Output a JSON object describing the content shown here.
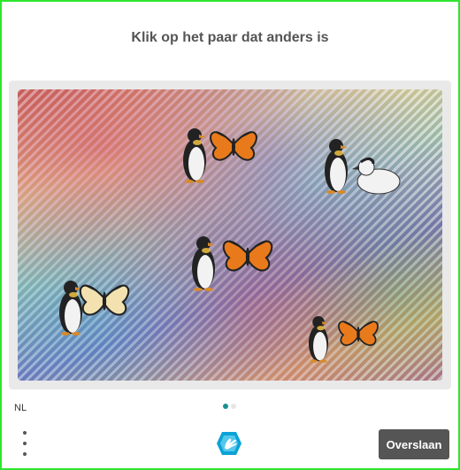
{
  "prompt": {
    "text": "Klik op het paar dat anders is"
  },
  "footer": {
    "language": "NL",
    "skip_label": "Overslaan"
  },
  "pagination": {
    "total": 2,
    "current": 1
  },
  "pairs": [
    {
      "id": "pair-1",
      "label": "penguin-butterfly"
    },
    {
      "id": "pair-2",
      "label": "penguin-duck"
    },
    {
      "id": "pair-3",
      "label": "penguin-butterfly"
    },
    {
      "id": "pair-4",
      "label": "penguin-butterfly"
    },
    {
      "id": "pair-5",
      "label": "penguin-butterfly"
    }
  ],
  "colors": {
    "accent": "#1a8f94",
    "skip_bg": "#555555",
    "frame": "#2ee62e"
  }
}
